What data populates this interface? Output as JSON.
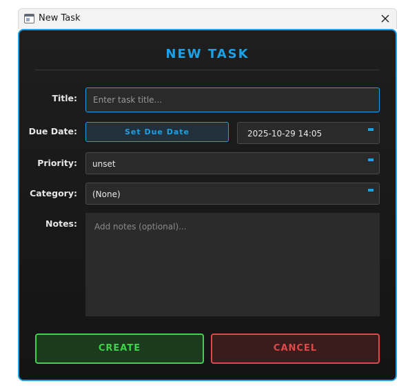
{
  "window": {
    "title": "New Task"
  },
  "dialog": {
    "heading": "NEW TASK"
  },
  "form": {
    "title_label": "Title:",
    "title_placeholder": "Enter task title...",
    "title_value": "",
    "due_label": "Due Date:",
    "due_button": "Set Due Date",
    "due_value": "2025-10-29 14:05",
    "priority_label": "Priority:",
    "priority_value": "unset",
    "category_label": "Category:",
    "category_value": "(None)",
    "notes_label": "Notes:",
    "notes_placeholder": "Add notes (optional)...",
    "notes_value": ""
  },
  "actions": {
    "create_label": "CREATE",
    "cancel_label": "CANCEL"
  },
  "colors": {
    "accent": "#1da1e6",
    "create": "#3ed34a",
    "cancel": "#e04848",
    "background": "#1a1a1a"
  },
  "icons": {
    "app": "app-window-icon",
    "close": "close-icon",
    "dropdown": "dropdown-indicator-icon"
  }
}
